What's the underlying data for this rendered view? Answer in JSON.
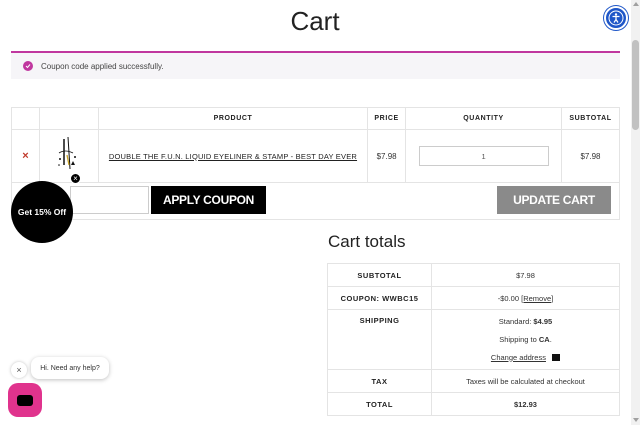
{
  "page": {
    "title": "Cart"
  },
  "notice": {
    "message": "Coupon code applied successfully."
  },
  "cart_table": {
    "headers": {
      "product": "PRODUCT",
      "price": "PRICE",
      "quantity": "QUANTITY",
      "subtotal": "SUBTOTAL"
    },
    "items": [
      {
        "remove": "×",
        "name": "DOUBLE THE F.U.N. LIQUID EYELINER & STAMP - BEST DAY EVER",
        "price": "$7.98",
        "quantity": "1",
        "subtotal": "$7.98"
      }
    ]
  },
  "actions": {
    "apply_coupon": "APPLY COUPON",
    "update_cart": "UPDATE CART",
    "coupon_placeholder": ""
  },
  "popup": {
    "label": "Get 15% Off",
    "close": "×"
  },
  "totals": {
    "title": "Cart totals",
    "subtotal_label": "SUBTOTAL",
    "subtotal_value": "$7.98",
    "coupon_label": "COUPON: WWBC15",
    "coupon_value": "-$0.00",
    "coupon_remove": "[Remove]",
    "shipping_label": "SHIPPING",
    "shipping_method": "Standard:",
    "shipping_price": "$4.95",
    "shipping_to_prefix": "Shipping to",
    "shipping_to_region": "CA",
    "change_address": "Change address",
    "tax_label": "TAX",
    "tax_value": "Taxes will be calculated at checkout",
    "total_label": "TOTAL",
    "total_value": "$12.93"
  },
  "chat": {
    "message": "Hi. Need any help?",
    "close": "×"
  },
  "colors": {
    "accent": "#c0379f",
    "chat_button": "#e0338d",
    "a11y": "#1e56c8"
  }
}
